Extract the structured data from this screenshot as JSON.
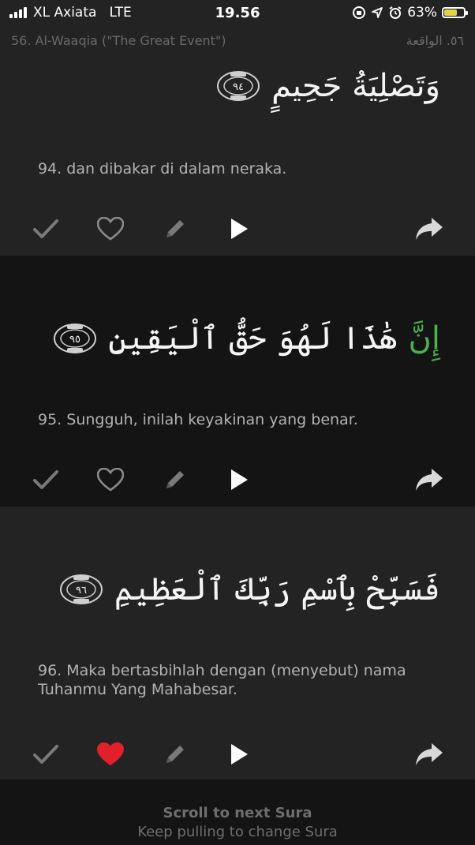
{
  "status_bar": {
    "carrier": "XL Axiata",
    "network": "LTE",
    "time": "19.56",
    "battery_percent": "63%"
  },
  "sura_header": {
    "title_latin": "56. Al-Waaqia (\"The Great Event\")",
    "title_arabic": "٥٦. الواقعة"
  },
  "ayahs": [
    {
      "number_arabic": "٩٤",
      "arabic_text": "وَتَصْلِيَةُ جَحِيمٍ",
      "arabic_highlight": "",
      "translation": "94. dan dibakar di dalam neraka.",
      "favorite": false
    },
    {
      "number_arabic": "٩٥",
      "arabic_text": "هَٰذَا لَهُوَ حَقُّ ٱلْيَقِينِ",
      "arabic_highlight": "إِنَّ",
      "translation": "95. Sungguh, inilah keyakinan yang benar.",
      "favorite": false
    },
    {
      "number_arabic": "٩٦",
      "arabic_text": "فَسَبِّحْ بِٱسْمِ رَبِّكَ ٱلْعَظِيمِ",
      "arabic_highlight": "",
      "translation": "96. Maka bertasbihlah dengan (menyebut) nama Tuhanmu Yang Mahabesar.",
      "favorite": true
    }
  ],
  "icons": {
    "check": "check-icon",
    "heart": "heart-icon",
    "pencil": "pencil-icon",
    "play": "play-icon",
    "share": "share-icon"
  },
  "colors": {
    "favorite_active": "#e0212b",
    "highlight_green": "#4caf50"
  },
  "footer": {
    "line1": "Scroll to next Sura",
    "line2": "Keep pulling to change Sura"
  }
}
